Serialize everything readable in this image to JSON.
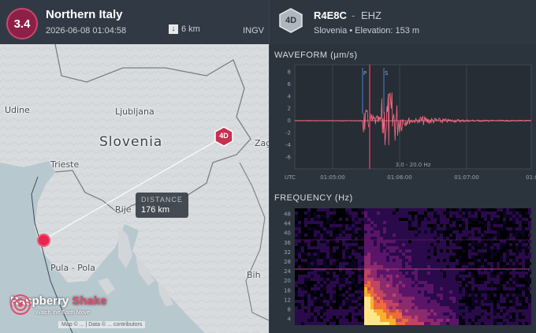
{
  "event": {
    "magnitude": "3.4",
    "region": "Northern Italy",
    "datetime": "2026-06-08 01:04:58",
    "depth": "6 km",
    "source": "INGV"
  },
  "map": {
    "labels": {
      "country": "Slovenia",
      "ljubljana": "Ljubljana",
      "udine": "Udine",
      "trieste": "Trieste",
      "rijeka": "Rije",
      "pula": "Pula - Pola",
      "zagreb": "Zag",
      "bih": "Bih"
    },
    "distance_label": "DISTANCE",
    "distance_value": "176 km",
    "station_marker": "4D",
    "epicenter_color": "#e7264d",
    "brand": {
      "name_a": "Raspberry",
      "name_b": "Shake",
      "tagline": "Watch the Earth Move"
    },
    "attribution": "Map © ... | Data © ... contributors"
  },
  "station": {
    "badge": "4D",
    "code": "R4E8C",
    "separator": "-",
    "channel": "EHZ",
    "location": "Slovenia • Elevation: 153 m"
  },
  "waveform": {
    "title": "WAVEFORM (μm/s)",
    "y_ticks": [
      "8",
      "6",
      "4",
      "2",
      "0",
      "-2",
      "-4",
      "-6"
    ],
    "x_ticks": [
      "UTC",
      "01:05:00",
      "01:06:00",
      "01:07:00",
      "01:0"
    ],
    "phase_p": "P",
    "phase_s": "S",
    "filter": "3.0 - 20.0 Hz",
    "trace_color": "#ff6b84",
    "pick_color": "#4a7fd0"
  },
  "frequency": {
    "title": "FREQUENCY (Hz)",
    "y_ticks": [
      "48",
      "44",
      "40",
      "36",
      "32",
      "28",
      "24",
      "20",
      "16",
      "12",
      "8",
      "4"
    ]
  }
}
